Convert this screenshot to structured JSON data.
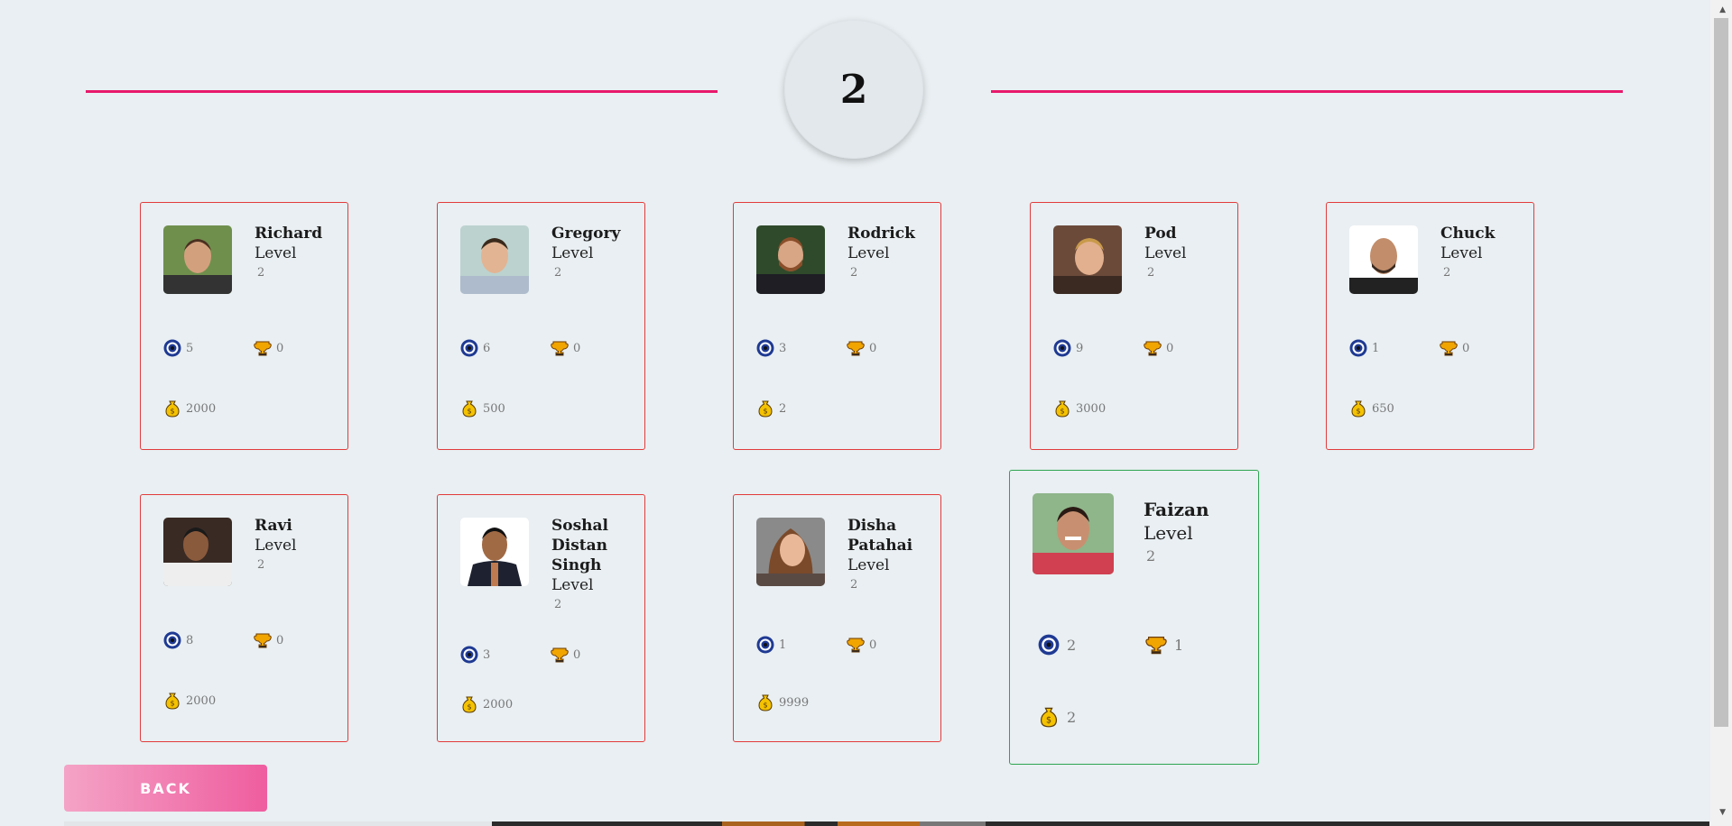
{
  "level": "2",
  "back_label": "BACK",
  "colors": {
    "accent_line": "#e8196b",
    "card_border": "#e23b3b",
    "active_border": "#2ea44f",
    "button_gradient_start": "#f4a3c6",
    "button_gradient_end": "#ef5d9f"
  },
  "icons": {
    "target": "target-icon",
    "trophy": "trophy-icon",
    "coins": "money-bag-icon"
  },
  "players": [
    {
      "name": "Richard",
      "level_label": "Level",
      "level": "2",
      "target": "5",
      "trophy": "0",
      "coins": "2000",
      "active": false
    },
    {
      "name": "Gregory",
      "level_label": "Level",
      "level": "2",
      "target": "6",
      "trophy": "0",
      "coins": "500",
      "active": false
    },
    {
      "name": "Rodrick",
      "level_label": "Level",
      "level": "2",
      "target": "3",
      "trophy": "0",
      "coins": "2",
      "active": false
    },
    {
      "name": "Pod",
      "level_label": "Level",
      "level": "2",
      "target": "9",
      "trophy": "0",
      "coins": "3000",
      "active": false
    },
    {
      "name": "Chuck",
      "level_label": "Level",
      "level": "2",
      "target": "1",
      "trophy": "0",
      "coins": "650",
      "active": false
    },
    {
      "name": "Ravi",
      "level_label": "Level",
      "level": "2",
      "target": "8",
      "trophy": "0",
      "coins": "2000",
      "active": false
    },
    {
      "name": "Soshal Distan Singh",
      "level_label": "Level",
      "level": "2",
      "target": "3",
      "trophy": "0",
      "coins": "2000",
      "active": false
    },
    {
      "name": "Disha Patahai",
      "level_label": "Level",
      "level": "2",
      "target": "1",
      "trophy": "0",
      "coins": "9999",
      "active": false
    },
    {
      "name": "Faizan",
      "level_label": "Level",
      "level": "2",
      "target": "2",
      "trophy": "1",
      "coins": "2",
      "active": true
    }
  ]
}
